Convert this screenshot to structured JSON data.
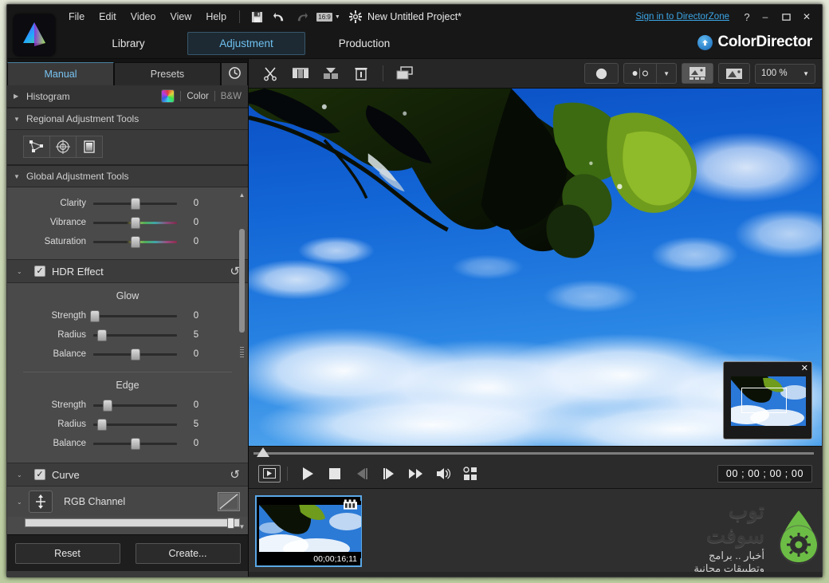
{
  "window": {
    "project_title": "New Untitled Project*",
    "signin_label": "Sign in to DirectorZone",
    "help_label": "?",
    "minimize_label": "–",
    "maximize_label": "❐",
    "close_label": "✕",
    "brand_name": "ColorDirector"
  },
  "menu": {
    "items": [
      {
        "label": "File"
      },
      {
        "label": "Edit"
      },
      {
        "label": "Video"
      },
      {
        "label": "View"
      },
      {
        "label": "Help"
      }
    ],
    "icons": [
      {
        "name": "save-icon"
      },
      {
        "name": "undo-icon"
      },
      {
        "name": "redo-icon"
      },
      {
        "name": "aspect-ratio-icon",
        "label": "16:9"
      },
      {
        "name": "settings-gear-icon"
      }
    ]
  },
  "modes": {
    "items": [
      {
        "label": "Library",
        "active": false
      },
      {
        "label": "Adjustment",
        "active": true
      },
      {
        "label": "Production",
        "active": false
      }
    ]
  },
  "left_panel": {
    "tabs": [
      {
        "label": "Manual",
        "active": true
      },
      {
        "label": "Presets",
        "active": false
      },
      {
        "label": "",
        "icon": "history-clock-icon",
        "active": false
      }
    ],
    "histogram": {
      "title": "Histogram",
      "color_label": "Color",
      "bw_label": "B&W",
      "wheel_icon": "color-wheel-icon"
    },
    "regional": {
      "title": "Regional Adjustment Tools",
      "tools": [
        {
          "name": "selection-mask-icon"
        },
        {
          "name": "radial-gradient-icon"
        },
        {
          "name": "gradient-mask-icon"
        }
      ]
    },
    "global": {
      "title": "Global Adjustment Tools",
      "sliders": [
        {
          "label": "Clarity",
          "value": "0",
          "pos": 50,
          "grad": "none"
        },
        {
          "label": "Vibrance",
          "value": "0",
          "pos": 50,
          "grad": "vib"
        },
        {
          "label": "Saturation",
          "value": "0",
          "pos": 50,
          "grad": "sat"
        }
      ]
    },
    "hdr": {
      "title": "HDR Effect",
      "checked": true,
      "reset_icon": "reset-arrow-icon",
      "groups": [
        {
          "title": "Glow",
          "sliders": [
            {
              "label": "Strength",
              "value": "0",
              "pos": 2
            },
            {
              "label": "Radius",
              "value": "5",
              "pos": 10
            },
            {
              "label": "Balance",
              "value": "0",
              "pos": 50
            }
          ]
        },
        {
          "title": "Edge",
          "sliders": [
            {
              "label": "Strength",
              "value": "0",
              "pos": 17
            },
            {
              "label": "Radius",
              "value": "5",
              "pos": 10
            },
            {
              "label": "Balance",
              "value": "0",
              "pos": 50
            }
          ]
        }
      ]
    },
    "curve": {
      "title": "Curve",
      "checked": true,
      "reset_icon": "reset-arrow-icon",
      "channel_label": "RGB Channel",
      "channel_icon": "vertical-move-icon",
      "curve_icon": "curve-graph-icon"
    },
    "footer": {
      "reset_label": "Reset",
      "create_label": "Create..."
    }
  },
  "main_toolbar": {
    "buttons": [
      {
        "name": "cut-scissors-icon"
      },
      {
        "name": "split-clips-icon"
      },
      {
        "name": "merge-clips-icon"
      },
      {
        "name": "delete-trash-icon"
      },
      {
        "name": "duplicate-window-icon"
      }
    ],
    "right": {
      "mask_circle_icon": "mask-circle-icon",
      "compare_dots_icon": "compare-dots-icon",
      "dropdown_caret": "▼",
      "split_view_icon": "split-view-icon",
      "single_view_icon": "single-view-icon",
      "zoom_value": "100 %"
    }
  },
  "preview": {
    "pip": {
      "close_label": "✕",
      "name": "navigator-overlay"
    }
  },
  "player": {
    "buttons": [
      {
        "name": "frame-marker-button"
      },
      {
        "name": "play-button"
      },
      {
        "name": "stop-button"
      },
      {
        "name": "prev-frame-button"
      },
      {
        "name": "next-frame-button"
      },
      {
        "name": "fast-forward-button"
      },
      {
        "name": "volume-button"
      },
      {
        "name": "grid-view-button"
      }
    ],
    "timecode": "00 ; 00 ; 00 ; 00"
  },
  "tray": {
    "clip": {
      "duration": "00;00;16;11",
      "badge_icon": "film-strip-icon"
    },
    "watermark": {
      "title": "توب سوفت",
      "subtitle": "أخبار .. برامج وتطبيقات مجانية",
      "logo_icon": "gear-droplet-logo"
    }
  },
  "colors": {
    "accent_blue": "#6fc0f0",
    "link_blue": "#3ba7e8",
    "selection_blue": "#5aa8e6",
    "panel_bg": "#3a3a3a",
    "slider_bg": "#4a4a4a",
    "watermark_green": "#6cbd45"
  }
}
